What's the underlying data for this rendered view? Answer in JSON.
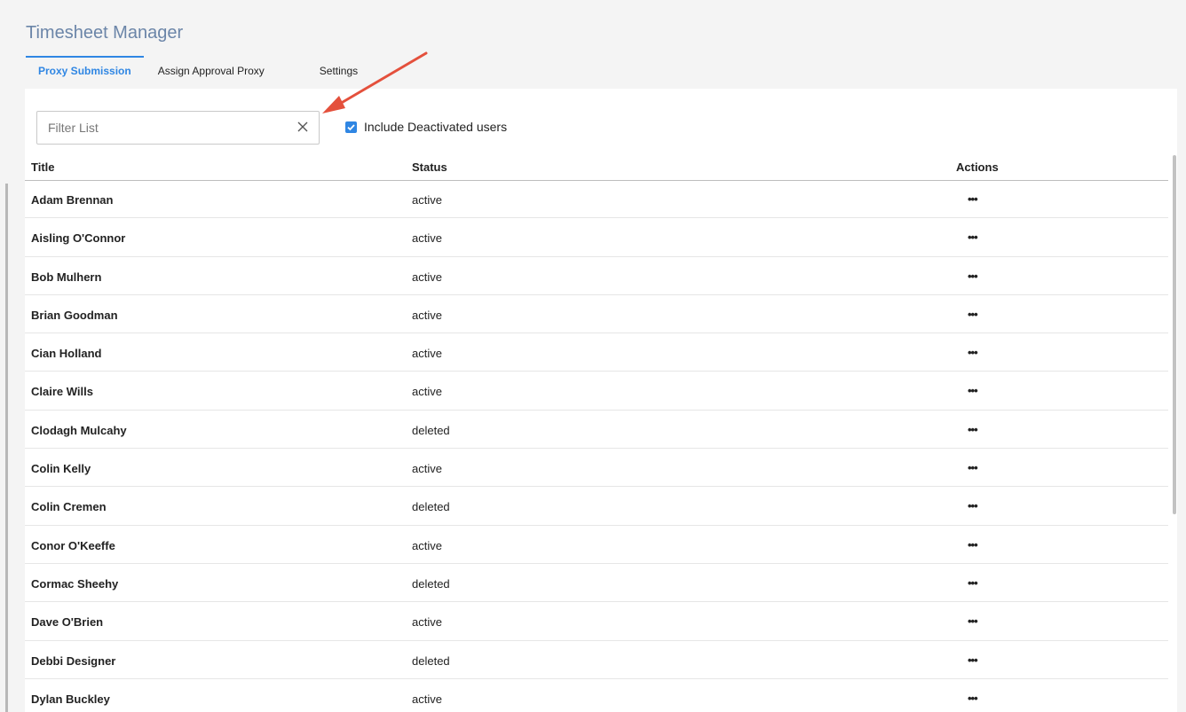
{
  "app": {
    "title": "Timesheet Manager"
  },
  "tabs": [
    {
      "label": "Proxy Submission",
      "active": true
    },
    {
      "label": "Assign Approval Proxy",
      "active": false
    },
    {
      "label": "Settings",
      "active": false
    }
  ],
  "filter": {
    "placeholder": "Filter List",
    "value": "",
    "clear_icon": "close-icon"
  },
  "include_deactivated": {
    "label": "Include Deactivated users",
    "checked": true
  },
  "table": {
    "columns": [
      "Title",
      "Status",
      "Actions"
    ],
    "rows": [
      {
        "title": "Adam Brennan",
        "status": "active",
        "action": "•••"
      },
      {
        "title": "Aisling O'Connor",
        "status": "active",
        "action": "•••"
      },
      {
        "title": "Bob Mulhern",
        "status": "active",
        "action": "•••"
      },
      {
        "title": "Brian Goodman",
        "status": "active",
        "action": "•••"
      },
      {
        "title": "Cian Holland",
        "status": "active",
        "action": "•••"
      },
      {
        "title": "Claire Wills",
        "status": "active",
        "action": "•••"
      },
      {
        "title": "Clodagh Mulcahy",
        "status": "deleted",
        "action": "•••"
      },
      {
        "title": "Colin Kelly",
        "status": "active",
        "action": "•••"
      },
      {
        "title": "Colin Cremen",
        "status": "deleted",
        "action": "•••"
      },
      {
        "title": "Conor O'Keeffe",
        "status": "active",
        "action": "•••"
      },
      {
        "title": "Cormac Sheehy",
        "status": "deleted",
        "action": "•••"
      },
      {
        "title": "Dave O'Brien",
        "status": "active",
        "action": "•••"
      },
      {
        "title": "Debbi Designer",
        "status": "deleted",
        "action": "•••"
      },
      {
        "title": "Dylan Buckley",
        "status": "active",
        "action": "•••"
      }
    ]
  },
  "colors": {
    "accent": "#2f86e3",
    "title": "#6b85a8",
    "annotation_arrow": "#e4503c"
  }
}
